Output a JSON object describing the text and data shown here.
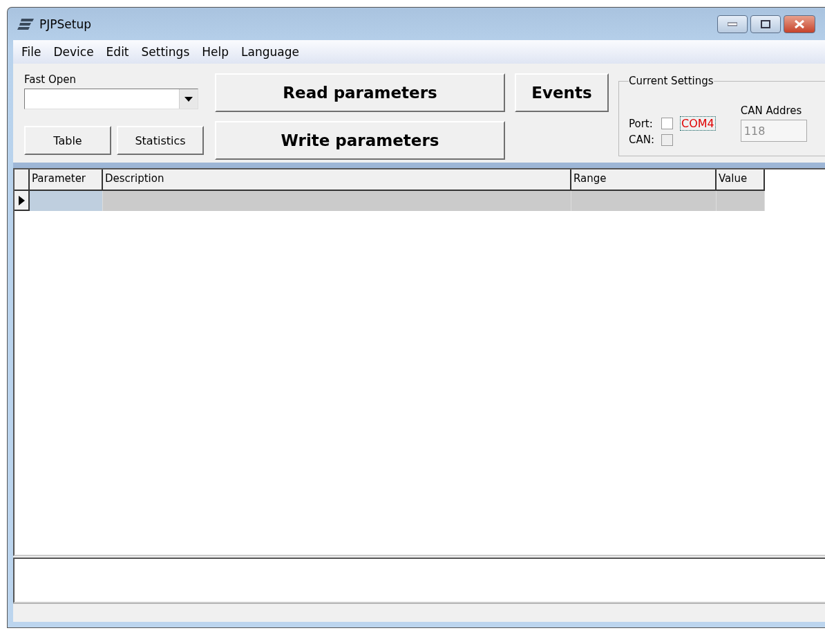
{
  "window": {
    "title": "PJPSetup"
  },
  "menu": [
    "File",
    "Device",
    "Edit",
    "Settings",
    "Help",
    "Language"
  ],
  "fast_open": {
    "label": "Fast Open"
  },
  "buttons": {
    "table": "Table",
    "statistics": "Statistics",
    "read": "Read parameters",
    "write": "Write parameters",
    "events": "Events"
  },
  "current_settings": {
    "title": "Current Settings",
    "port": {
      "label": "Port:",
      "checked": false,
      "value": "COM4"
    },
    "can": {
      "label": "CAN:",
      "checked": false,
      "disabled": true
    },
    "can_address": {
      "label": "CAN Addres",
      "value": "118",
      "disabled": true
    }
  },
  "table": {
    "columns": [
      "Parameter",
      "Description",
      "Range",
      "Value"
    ],
    "rows": [
      {
        "current": true
      }
    ]
  }
}
